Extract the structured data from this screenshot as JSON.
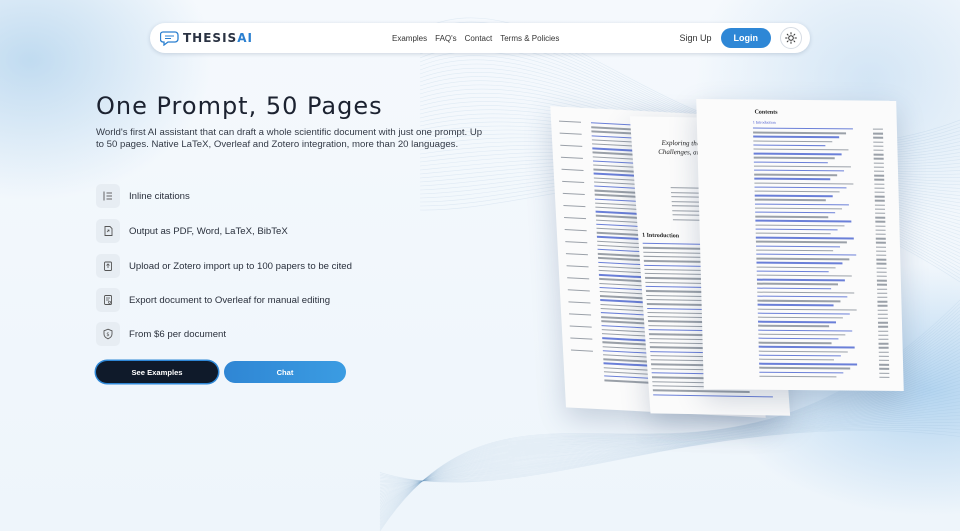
{
  "nav": {
    "logo_prefix": "THESIS",
    "logo_suffix": "AI",
    "links": [
      "Examples",
      "FAQ's",
      "Contact",
      "Terms & Policies"
    ],
    "signup": "Sign Up",
    "login": "Login"
  },
  "hero": {
    "title": "One Prompt, 50 Pages",
    "subtitle": "World's first AI assistant that can draft a whole scientific document with just one prompt. Up to 50 pages. Native LaTeX, Overleaf and Zotero integration, more than 20 languages."
  },
  "features": [
    {
      "icon": "list-icon",
      "label": "Inline citations"
    },
    {
      "icon": "document-export-icon",
      "label": "Output as PDF, Word, LaTeX, BibTeX"
    },
    {
      "icon": "upload-icon",
      "label": "Upload or Zotero import up to 100 papers to be cited"
    },
    {
      "icon": "overleaf-icon",
      "label": "Export document to Overleaf for manual editing"
    },
    {
      "icon": "price-shield-icon",
      "label": "From $6 per document"
    }
  ],
  "buttons": {
    "examples": "See Examples",
    "chat": "Chat"
  },
  "preview": {
    "contents_heading": "Contents",
    "intro_heading": "1 Introduction",
    "paper_title_fragment": "Exploring the B",
    "paper_title_fragment2": "Challenges, and tr",
    "contents_first_entry": "1 Introduction"
  },
  "colors": {
    "accent": "#2e87d6",
    "dark_button": "#0f1a2a",
    "text": "#1c2230"
  }
}
